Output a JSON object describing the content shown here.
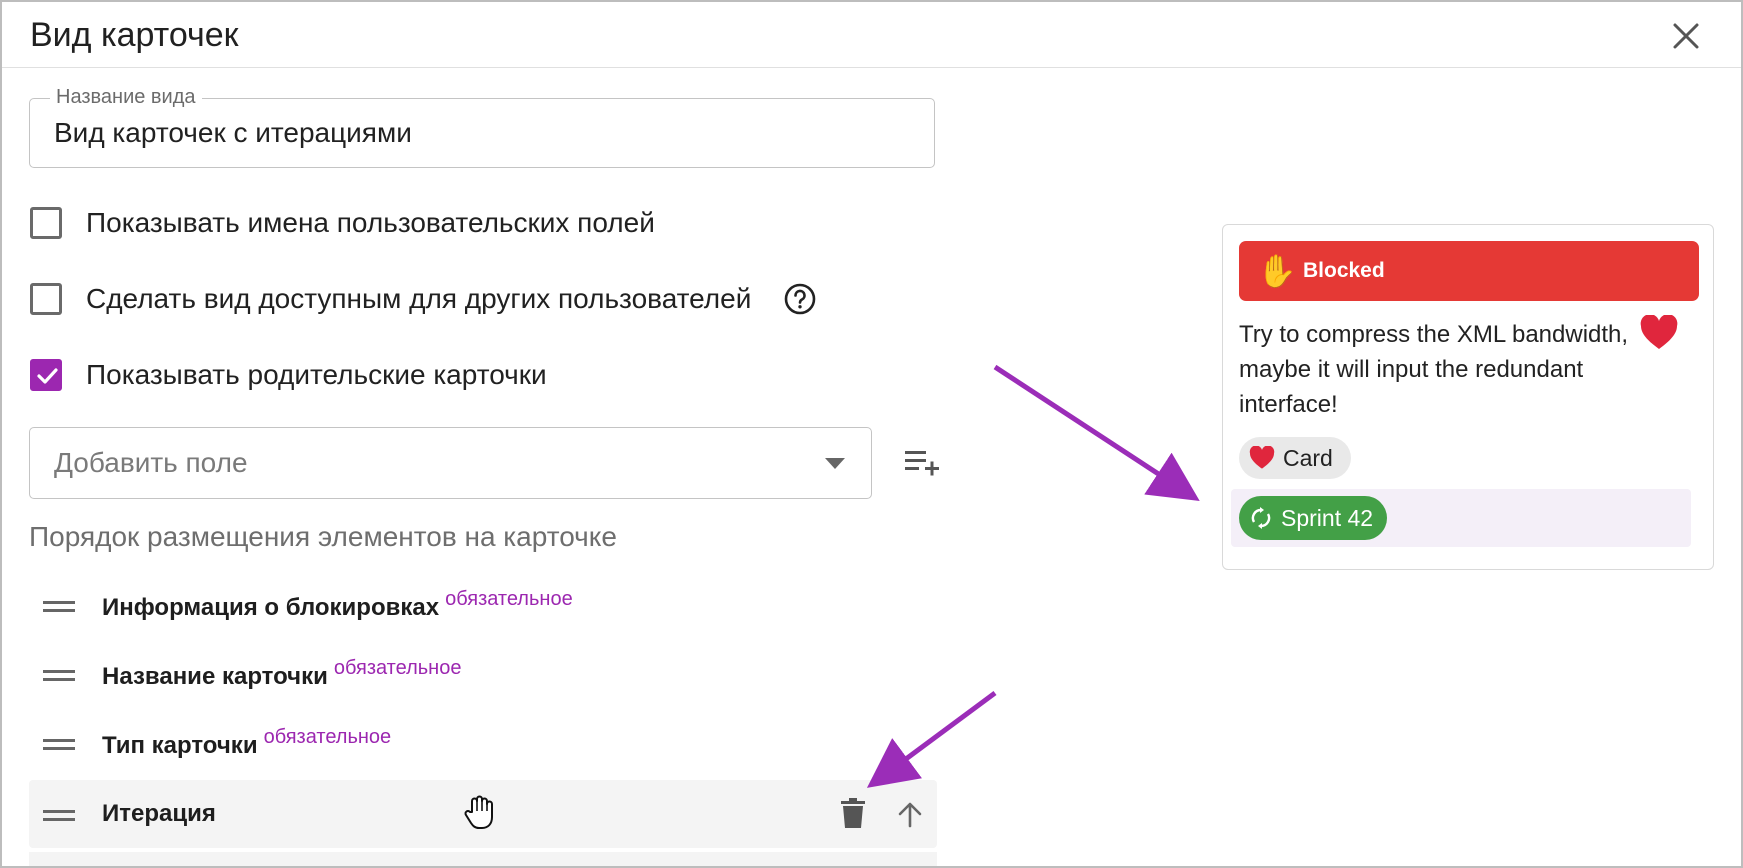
{
  "dialog": {
    "title": "Вид карточек",
    "close_icon": "close-icon"
  },
  "name_field": {
    "label": "Название вида",
    "value": "Вид карточек с итерациями"
  },
  "checkboxes": [
    {
      "label": "Показывать имена пользовательских полей",
      "checked": false
    },
    {
      "label": "Сделать вид доступным для других пользователей",
      "checked": false,
      "help_icon": "help-circle-icon"
    },
    {
      "label": "Показывать родительские карточки",
      "checked": true
    }
  ],
  "add_field": {
    "placeholder": "Добавить поле",
    "icon": "playlist-add-icon"
  },
  "order_section": {
    "title": "Порядок размещения элементов на карточке",
    "required_badge": "обязательное",
    "items": [
      {
        "label": "Информация о блокировках",
        "required": true
      },
      {
        "label": "Название карточки",
        "required": true
      },
      {
        "label": "Тип карточки",
        "required": true
      },
      {
        "label": "Итерация",
        "required": false,
        "active": true
      }
    ]
  },
  "preview_card": {
    "blocked_label": "Blocked",
    "blocked_icon": "✋",
    "text": "Try to compress the XML bandwidth, maybe it will input the redundant interface!",
    "card_type_chip": "Card",
    "sprint_chip": "Sprint 42"
  },
  "colors": {
    "accent": "#9c27b0",
    "blocked": "#e53935",
    "sprint": "#43a047",
    "heart": "#e0263d",
    "annotation_arrow": "#9b2db8"
  }
}
